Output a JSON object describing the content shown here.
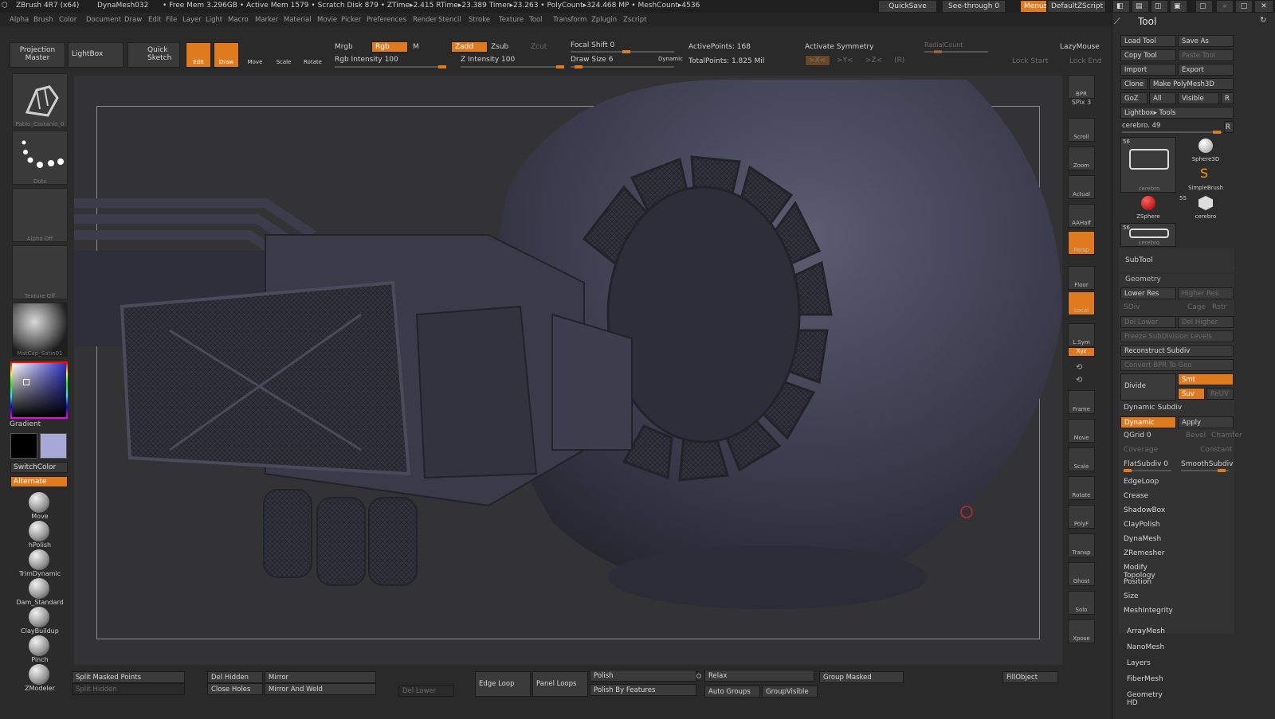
{
  "titlebar": {
    "app": "ZBrush 4R7 (x64)",
    "doc": "DynaMesh032",
    "stats": "• Free Mem 3.296GB • Active Mem 1579 • Scratch Disk 879 • ZTime▸2.415 RTime▸23.389 Timer▸23.263 • PolyCount▸324.468 MP • MeshCount▸4536",
    "quicksave": "QuickSave",
    "seethrough": "See-through  0",
    "menus": "Menus",
    "script": "DefaultZScript"
  },
  "menubar": [
    "Alpha",
    "Brush",
    "Color",
    "Document",
    "Draw",
    "Edit",
    "File",
    "Layer",
    "Light",
    "Macro",
    "Marker",
    "Material",
    "Movie",
    "Picker",
    "Preferences",
    "Render",
    "Stencil",
    "Stroke",
    "Texture",
    "Tool",
    "Transform",
    "Zplugin",
    "Zscript"
  ],
  "top": {
    "projection_master": "Projection Master",
    "lightbox": "LightBox",
    "quick_sketch": "Quick Sketch",
    "edit": "Edit",
    "draw": "Draw",
    "move": "Move",
    "scale": "Scale",
    "rotate": "Rotate",
    "mrgb": "Mrgb",
    "rgb": "Rgb",
    "m": "M",
    "rgb_intensity": "Rgb  Intensity 100",
    "zadd": "Zadd",
    "zsub": "Zsub",
    "zcut": "Zcut",
    "z_intensity": "Z Intensity 100",
    "focal_shift": "Focal Shift 0",
    "draw_size": "Draw Size 6",
    "dynamic": "Dynamic",
    "active_points": "ActivePoints: 168",
    "total_points": "TotalPoints: 1.825 Mil",
    "activate_symmetry": "Activate Symmetry",
    "radial_count": "RadialCount",
    "sym_x": ">X<",
    "sym_y": ">Y<",
    "sym_z": ">Z<",
    "sym_r": "(R)",
    "lazymouse": "LazyMouse",
    "lock_start": "Lock Start",
    "lock_end": "Lock End"
  },
  "left": {
    "thumb1": "Pablo_Castanio_0",
    "dots": "Dots",
    "alpha": "Alpha Off",
    "texture": "Texture Off",
    "matcap": "MatCap_Satin01",
    "gradient": "Gradient",
    "switchcolor": "SwitchColor",
    "alternate": "Alternate",
    "brushes": [
      "Move",
      "hPolish",
      "TrimDynamic",
      "Dam_Standard",
      "ClayBuildup",
      "Pinch",
      "ZModeler"
    ]
  },
  "right": [
    "BPR",
    "SPix 3",
    "Scroll",
    "Zoom",
    "Actual",
    "AAHalf",
    "Persp",
    "Floor",
    "Local",
    "L.Sym",
    "Xyz",
    "",
    "",
    "Frame",
    "Move",
    "Scale",
    "Rotate",
    "PolyF",
    "Transp",
    "Ghost",
    "Solo",
    "Xpose"
  ],
  "panel": {
    "title": "Tool",
    "load_tool": "Load Tool",
    "save_as": "Save As",
    "copy_tool": "Copy Tool",
    "paste_tool": "Paste Tool",
    "import": "Import",
    "export": "Export",
    "clone": "Clone",
    "make_polymesh": "Make PolyMesh3D",
    "goz": "GoZ",
    "all": "All",
    "visible": "Visible",
    "r": "R",
    "lightbox_tools": "Lightbox▸ Tools",
    "cerebro_slider": "cerebro. 49",
    "thumbs": [
      {
        "count": "56",
        "name": "cerebro"
      },
      {
        "count": "",
        "name": "Sphere3D"
      },
      {
        "count": "",
        "name": "SimpleBrush"
      },
      {
        "count": "",
        "name": "ZSphere"
      },
      {
        "count": "55",
        "name": "cerebro"
      },
      {
        "count": "56",
        "name": "cerebro"
      }
    ],
    "subtool": "SubTool",
    "geometry": "Geometry",
    "lower_res": "Lower Res",
    "higher_res": "Higher Res",
    "sdiv": "SDiv",
    "cage": "Cage",
    "rstr": "Rstr",
    "del_lower": "Del Lower",
    "del_higher": "Del Higher",
    "freeze": "Freeze SubDivision Levels",
    "reconstruct": "Reconstruct Subdiv",
    "convert_bpr": "Convert BPR To Geo",
    "divide": "Divide",
    "smt": "Smt",
    "suv": "Suv",
    "reuv": "ReUV",
    "dynamic_subdiv": "Dynamic Subdiv",
    "dynamic": "Dynamic",
    "apply": "Apply",
    "qgrid": "QGrid 0",
    "bevel": "Bevel",
    "chamfer": "Chamfer",
    "coverage": "Coverage",
    "constant": "Constant",
    "flatsubdiv": "FlatSubdiv 0",
    "smoothsubdiv": "SmoothSubdiv",
    "items": [
      "EdgeLoop",
      "Crease",
      "ShadowBox",
      "ClayPolish",
      "DynaMesh",
      "ZRemesher",
      "Modify Topology",
      "Position",
      "Size",
      "MeshIntegrity"
    ],
    "sections": [
      "ArrayMesh",
      "NanoMesh",
      "Layers",
      "FiberMesh",
      "Geometry HD"
    ]
  },
  "bottom": {
    "split_masked": "Split Masked Points",
    "split_hidden": "Split Hidden",
    "del_hidden": "Del Hidden",
    "close_holes": "Close Holes",
    "mirror": "Mirror",
    "mirror_weld": "Mirror And Weld",
    "del_lower": "Del Lower",
    "edge_loop": "Edge Loop",
    "panel_loops": "Panel Loops",
    "polish": "Polish",
    "polish_features": "Polish By Features",
    "relax": "Relax",
    "auto_groups": "Auto Groups",
    "group_visible": "GroupVisible",
    "group_masked": "Group Masked",
    "fill_object": "FillObject"
  },
  "colors": {
    "accent": "#e07a1f",
    "bg": "#2b2b2b",
    "model": "#3c3c4e"
  }
}
